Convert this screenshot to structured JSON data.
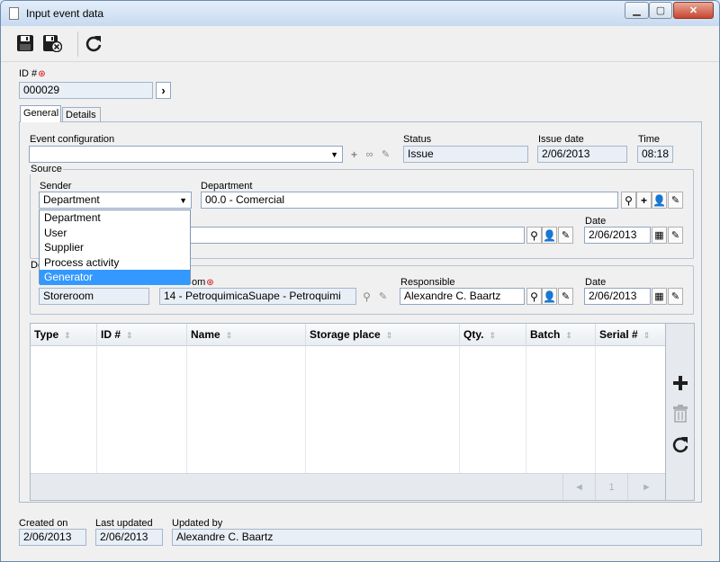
{
  "window": {
    "title": "Input event data",
    "controls": [
      "minimize",
      "maximize",
      "close"
    ]
  },
  "toolbar": {
    "icons": [
      "save-icon",
      "save-close-icon",
      "refresh-icon"
    ]
  },
  "id_field": {
    "label": "ID #",
    "required": "⊛",
    "value": "000029"
  },
  "tabs": [
    {
      "label": "General",
      "active": true
    },
    {
      "label": "Details",
      "active": false
    }
  ],
  "general": {
    "event_configuration": {
      "label": "Event configuration",
      "value": ""
    },
    "status": {
      "label": "Status",
      "value": "Issue"
    },
    "issue_date": {
      "label": "Issue date",
      "value": "2/06/2013"
    },
    "time": {
      "label": "Time",
      "value": "08:18"
    }
  },
  "source": {
    "group_label": "Source",
    "sender": {
      "label": "Sender",
      "value": "Department",
      "options": [
        "Department",
        "User",
        "Supplier",
        "Process activity",
        "Generator"
      ],
      "highlighted": "Generator"
    },
    "department": {
      "label": "Department",
      "value": "00.0 - Comercial"
    },
    "row2_value": "",
    "date": {
      "label": "Date",
      "value": "2/06/2013"
    }
  },
  "destination": {
    "group_label": "De",
    "type_value": "Storeroom",
    "storeroom_label": "om",
    "required": "⊛",
    "storeroom_value": "14 - PetroquimicaSuape - Petroquimi",
    "responsible": {
      "label": "Responsible",
      "value": "Alexandre C. Baartz"
    },
    "date": {
      "label": "Date",
      "value": "2/06/2013"
    }
  },
  "grid": {
    "columns": [
      "Type",
      "ID #",
      "Name",
      "Storage place",
      "Qty.",
      "Batch",
      "Serial #"
    ],
    "sort_glyph": "⇕",
    "pager": {
      "prev": "◄",
      "page": "1",
      "next": "►"
    }
  },
  "footer": {
    "created_on": {
      "label": "Created on",
      "value": "2/06/2013"
    },
    "last_updated": {
      "label": "Last updated",
      "value": "2/06/2013"
    },
    "updated_by": {
      "label": "Updated by",
      "value": "Alexandre C. Baartz"
    }
  }
}
